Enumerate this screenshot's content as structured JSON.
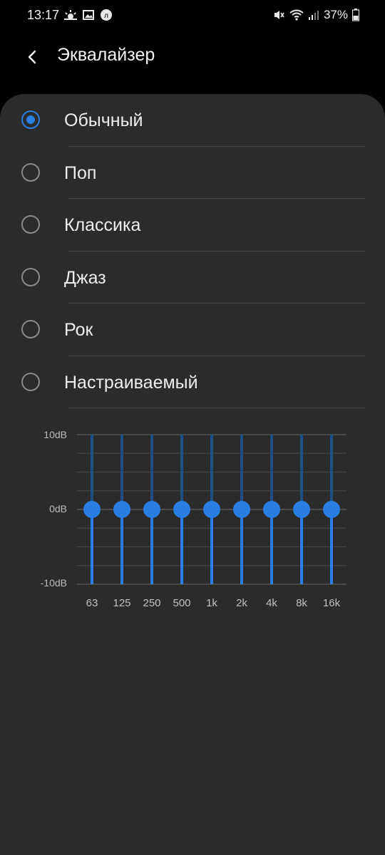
{
  "status": {
    "time": "13:17",
    "battery": "37%",
    "icons_left": [
      "weather-icon",
      "image-icon",
      "app-icon"
    ],
    "icons_right": [
      "mute-icon",
      "wifi-icon",
      "signal-icon",
      "battery-icon"
    ]
  },
  "header": {
    "title": "Эквалайзер",
    "back_icon": "chevron-left-icon"
  },
  "presets": {
    "selected": "Обычный",
    "items": [
      {
        "label": "Обычный",
        "checked": true
      },
      {
        "label": "Поп",
        "checked": false
      },
      {
        "label": "Классика",
        "checked": false
      },
      {
        "label": "Джаз",
        "checked": false
      },
      {
        "label": "Рок",
        "checked": false
      },
      {
        "label": "Настраиваемый",
        "checked": false
      }
    ]
  },
  "equalizer": {
    "db_labels": [
      "10dB",
      "0dB",
      "-10dB"
    ],
    "bands": [
      {
        "freq": "63",
        "value_db": 0
      },
      {
        "freq": "125",
        "value_db": 0
      },
      {
        "freq": "250",
        "value_db": 0
      },
      {
        "freq": "500",
        "value_db": 0
      },
      {
        "freq": "1k",
        "value_db": 0
      },
      {
        "freq": "2k",
        "value_db": 0
      },
      {
        "freq": "4k",
        "value_db": 0
      },
      {
        "freq": "8k",
        "value_db": 0
      },
      {
        "freq": "16k",
        "value_db": 0
      }
    ],
    "range_db": [
      -10,
      10
    ],
    "accent_color": "#2a7de1",
    "track_color": "#1f4f86"
  }
}
